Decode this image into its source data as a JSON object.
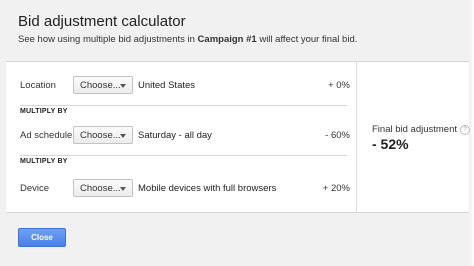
{
  "dialog": {
    "title": "Bid adjustment calculator",
    "subtitle_prefix": "See how using multiple bid adjustments in ",
    "campaign_name": "Campaign #1",
    "subtitle_suffix": " will affect your final bid."
  },
  "rows": [
    {
      "label": "Location",
      "select_label": "Choose...",
      "value": "United States",
      "adjustment": "+ 0%"
    },
    {
      "label": "Ad schedule",
      "select_label": "Choose...",
      "value": "Saturday - all day",
      "adjustment": "- 60%"
    },
    {
      "label": "Device",
      "select_label": "Choose...",
      "value": "Mobile devices with full browsers",
      "adjustment": "+ 20%"
    }
  ],
  "multiply_label": "MULTIPLY BY",
  "result": {
    "label": "Final bid adjustment",
    "help_glyph": "?",
    "value": "- 52%"
  },
  "footer": {
    "close_label": "Close"
  },
  "colors": {
    "dialog_bg": "#f1f1f1",
    "panel_bg": "#ffffff",
    "primary_button": "#4d87ec",
    "divider": "#d6d6d6"
  },
  "icons": {
    "dropdown": "chevron-down-icon",
    "help": "help-icon"
  }
}
